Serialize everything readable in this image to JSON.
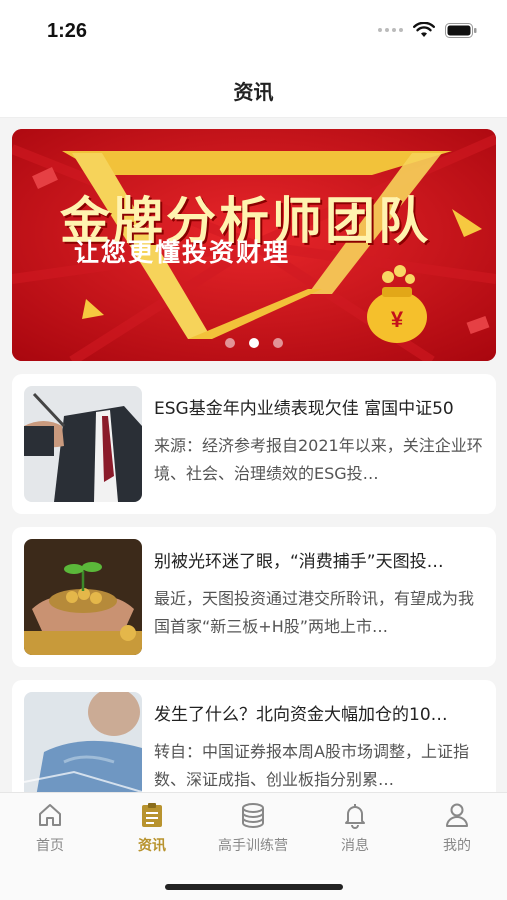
{
  "status_bar": {
    "time": "1:26"
  },
  "nav": {
    "title": "资讯"
  },
  "banner": {
    "title": "金牌分析师团队",
    "subtitle": "让您更懂投资财理",
    "bag_symbol": "¥",
    "slide_count": 3,
    "active_slide": 2
  },
  "news": [
    {
      "title": "ESG基金年内业绩表现欠佳 富国中证50",
      "desc": "来源：经济参考报自2021年以来，关注企业环境、社会、治理绩效的ESG投…"
    },
    {
      "title": "别被光环迷了眼，“消费捕手”天图投…",
      "desc": "最近，天图投资通过港交所聆讯，有望成为我国首家“新三板+H股”两地上市…"
    },
    {
      "title": "发生了什么？北向资金大幅加仓的10…",
      "desc": "转自：中国证券报本周A股市场调整，上证指数、深证成指、创业板指分别累…"
    }
  ],
  "tabs": [
    {
      "label": "首页",
      "icon": "home-icon",
      "active": false
    },
    {
      "label": "资讯",
      "icon": "news-icon",
      "active": true
    },
    {
      "label": "高手训练营",
      "icon": "coins-icon",
      "active": false
    },
    {
      "label": "消息",
      "icon": "bell-icon",
      "active": false
    },
    {
      "label": "我的",
      "icon": "person-icon",
      "active": false
    }
  ],
  "colors": {
    "accent": "#b8932e",
    "banner_red": "#c4101a",
    "inactive": "#888888"
  }
}
